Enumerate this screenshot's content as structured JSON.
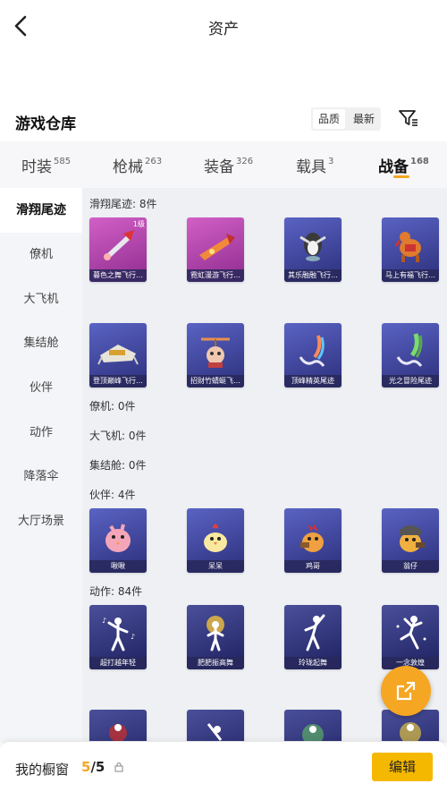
{
  "header": {
    "title": "资产"
  },
  "warehouse": {
    "title": "游戏仓库",
    "sort_options": [
      "品质",
      "最新"
    ]
  },
  "tabs": [
    {
      "label": "时装",
      "count": "585"
    },
    {
      "label": "枪械",
      "count": "263"
    },
    {
      "label": "装备",
      "count": "326"
    },
    {
      "label": "载具",
      "count": "3"
    },
    {
      "label": "战备",
      "count": "168"
    }
  ],
  "sidebar": {
    "items": [
      "滑翔尾迹",
      "僚机",
      "大飞机",
      "集结舱",
      "伙伴",
      "动作",
      "降落伞",
      "大厅场景"
    ]
  },
  "sections": {
    "glide": {
      "label": "滑翔尾迹: 8件",
      "items": [
        {
          "name": "暮色之舞飞行…",
          "level": "1级"
        },
        {
          "name": "霓虹漫游飞行…"
        },
        {
          "name": "其乐融融飞行…"
        },
        {
          "name": "马上有福飞行…"
        },
        {
          "name": "登顶巅峰飞行…"
        },
        {
          "name": "招财竹蜻蜓飞…"
        },
        {
          "name": "顶峰精英尾迹"
        },
        {
          "name": "光之冒险尾迹"
        }
      ]
    },
    "wingman": {
      "label": "僚机: 0件"
    },
    "bigplane": {
      "label": "大飞机: 0件"
    },
    "capsule": {
      "label": "集结舱: 0件"
    },
    "partner": {
      "label": "伙伴: 4件",
      "items": [
        {
          "name": "啾啾"
        },
        {
          "name": "呆呆"
        },
        {
          "name": "鸡哥"
        },
        {
          "name": "翁仔"
        }
      ]
    },
    "action": {
      "label": "动作: 84件",
      "items": [
        {
          "name": "超打越年轻"
        },
        {
          "name": "肥肥振高舞"
        },
        {
          "name": "玲珑起舞"
        },
        {
          "name": "一念敦煌"
        }
      ]
    }
  },
  "bottom": {
    "showcase_label": "我的橱窗",
    "count_current": "5",
    "count_sep": "/5",
    "edit_label": "编辑"
  },
  "colors": {
    "accent": "#f5a623",
    "edit_button": "#f5b800",
    "purple_rarity": "#b13fa8",
    "blue_rarity": "#3a3f8c"
  }
}
